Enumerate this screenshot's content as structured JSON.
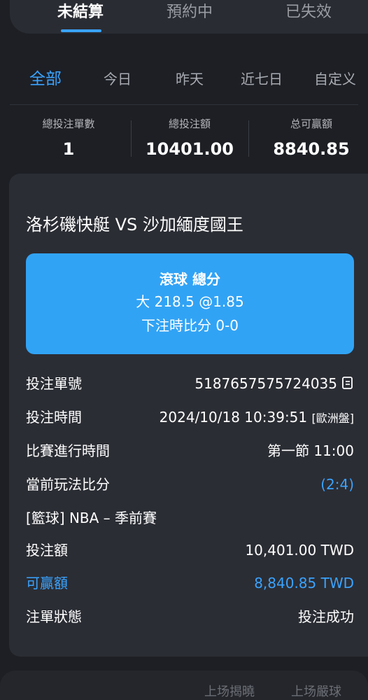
{
  "top_tabs": [
    {
      "label": "未結算"
    },
    {
      "label": "預約中"
    },
    {
      "label": "已失效"
    }
  ],
  "filter_tabs": [
    {
      "label": "全部"
    },
    {
      "label": "今日"
    },
    {
      "label": "昨天"
    },
    {
      "label": "近七日"
    },
    {
      "label": "自定义"
    }
  ],
  "summary": {
    "count_label": "總投注單數",
    "count_value": "1",
    "amount_label": "總投注額",
    "amount_value": "10401.00",
    "win_label": "总可贏額",
    "win_value": "8840.85"
  },
  "bet": {
    "match": "洛杉磯快艇 VS 沙加緬度國王",
    "type": "滾球  總分",
    "selection": "大 218.5 @1.85",
    "score_at_bet": "下注時比分 0-0",
    "rows": {
      "ticket_label": "投注單號",
      "ticket_value": "5187657575724035",
      "time_label": "投注時間",
      "time_value": "2024/10/18 10:39:51",
      "odds_format": "[歐洲盤]",
      "game_time_label": "比賽進行時間",
      "game_time_value": "第一節 11:00",
      "current_score_label": "當前玩法比分",
      "current_score_value": "(2:4)",
      "league": "[籃球] NBA – 季前賽",
      "stake_label": "投注額",
      "stake_value": "10,401.00 TWD",
      "win_label": "可贏額",
      "win_value": "8,840.85 TWD",
      "status_label": "注單狀態",
      "status_value": "投注成功"
    }
  },
  "bottom": {
    "left": "上场揭曉",
    "right": "上场嚴球"
  },
  "colors": {
    "accent": "#3aa3ff",
    "bet_box": "#31a3f5",
    "background": "#1d1f25",
    "card": "#2b2d34"
  },
  "icons": {
    "copy": "copy-icon"
  }
}
